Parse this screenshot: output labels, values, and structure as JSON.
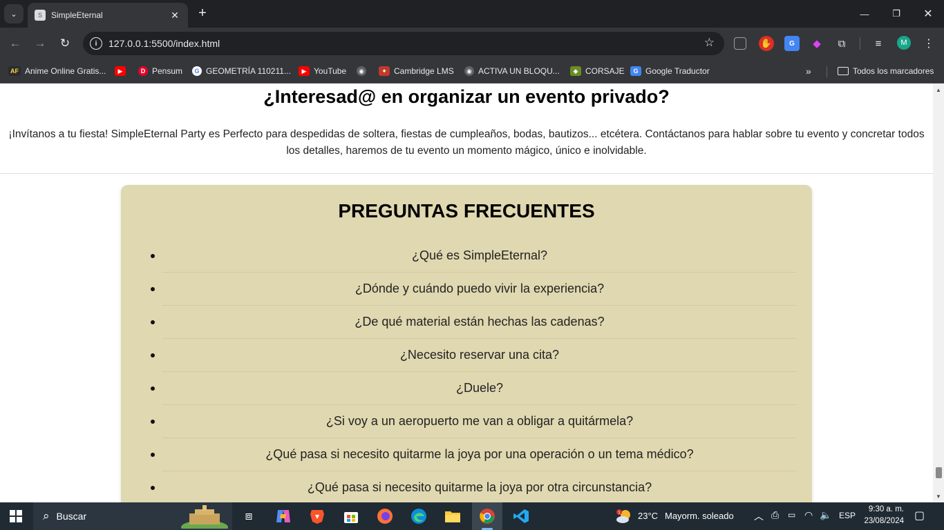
{
  "browser": {
    "tab_title": "SimpleEternal",
    "tab_favicon": "S",
    "url": "127.0.0.1:5500/index.html",
    "profile_initial": "M",
    "bookmarks": [
      {
        "label": "Anime Online Gratis...",
        "icon": "AF",
        "color": "#2b2b2b"
      },
      {
        "label": "",
        "icon": "▶",
        "color": "#ff0000"
      },
      {
        "label": "Pensum",
        "icon": "D",
        "color": "#e4002b"
      },
      {
        "label": "GEOMETRÍA 110211...",
        "icon": "G",
        "color": "#ffffff"
      },
      {
        "label": "YouTube",
        "icon": "▶",
        "color": "#ff0000"
      },
      {
        "label": "",
        "icon": "◉",
        "color": "#5f6368"
      },
      {
        "label": "Cambridge LMS",
        "icon": "✦",
        "color": "#c0392b"
      },
      {
        "label": "ACTIVA UN BLOQU...",
        "icon": "◉",
        "color": "#5f6368"
      },
      {
        "label": "CORSAJE",
        "icon": "◆",
        "color": "#6b8e23"
      },
      {
        "label": "Google Traductor",
        "icon": "G",
        "color": "#4285f4"
      }
    ],
    "all_bookmarks_label": "Todos los marcadores"
  },
  "page": {
    "event_title": "¿Interesad@ en organizar un evento privado?",
    "event_text_line1": "¡Invítanos a tu fiesta! SimpleEternal Party es Perfecto para despedidas de soltera, fiestas de cumpleaños, bodas, bautizos... etcétera. Contáctanos para hablar sobre tu evento y concretar todos",
    "event_text_line2": "los detalles, haremos de tu evento un momento mágico, único e inolvidable.",
    "faq_title": "PREGUNTAS FRECUENTES",
    "faq_items": [
      "¿Qué es SimpleEternal?",
      "¿Dónde y cuándo puedo vivir la experiencia?",
      "¿De qué material están hechas las cadenas?",
      "¿Necesito reservar una cita?",
      "¿Duele?",
      "¿Si voy a un aeropuerto me van a obligar a quitármela?",
      "¿Qué pasa si necesito quitarme la joya por una operación o un tema médico?",
      "¿Qué pasa si necesito quitarme la joya por otra circunstancia?"
    ],
    "faq_bg_color": "#e0d8b0"
  },
  "taskbar": {
    "search_label": "Buscar",
    "weather_temp": "23°C",
    "weather_desc": "Mayorm. soleado",
    "language": "ESP",
    "time": "9:30 a. m.",
    "date": "23/08/2024",
    "weather_badge": "1"
  }
}
